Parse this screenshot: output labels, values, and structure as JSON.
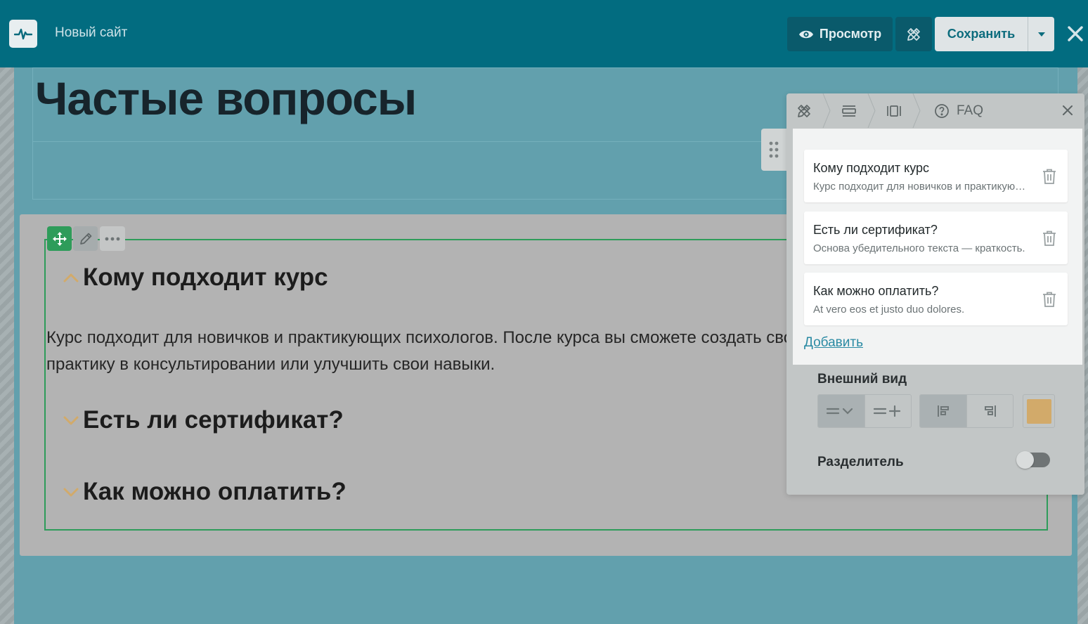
{
  "topbar": {
    "site_title": "Новый сайт",
    "preview_label": "Просмотр",
    "save_label": "Сохранить"
  },
  "page": {
    "heading": "Частые вопросы"
  },
  "faq": {
    "questions": [
      {
        "title": "Кому подходит курс",
        "expanded": true
      },
      {
        "title": "Есть ли сертификат?",
        "expanded": false
      },
      {
        "title": "Как можно оплатить?",
        "expanded": false
      }
    ],
    "answer": "Курс подходит для новичков и практикующих психологов. После курса вы сможете создать свою практику в консультировании или улучшить свои навыки."
  },
  "panel": {
    "breadcrumb_last": "FAQ",
    "items": [
      {
        "title": "Кому подходит курс",
        "subtitle": "Курс подходит для новичков и практикующих психологов."
      },
      {
        "title": "Есть ли сертификат?",
        "subtitle": "Основа убедительного текста — краткость."
      },
      {
        "title": "Как можно оплатить?",
        "subtitle": "At vero eos et justo duo dolores."
      }
    ],
    "add_label": "Добавить",
    "appearance_label": "Внешний вид",
    "divider_label": "Разделитель",
    "divider_enabled": false,
    "accent_color": "#d2aa6a"
  },
  "colors": {
    "topbar": "#026c80",
    "selection": "#2e9c5a",
    "link": "#2a8aa3"
  }
}
